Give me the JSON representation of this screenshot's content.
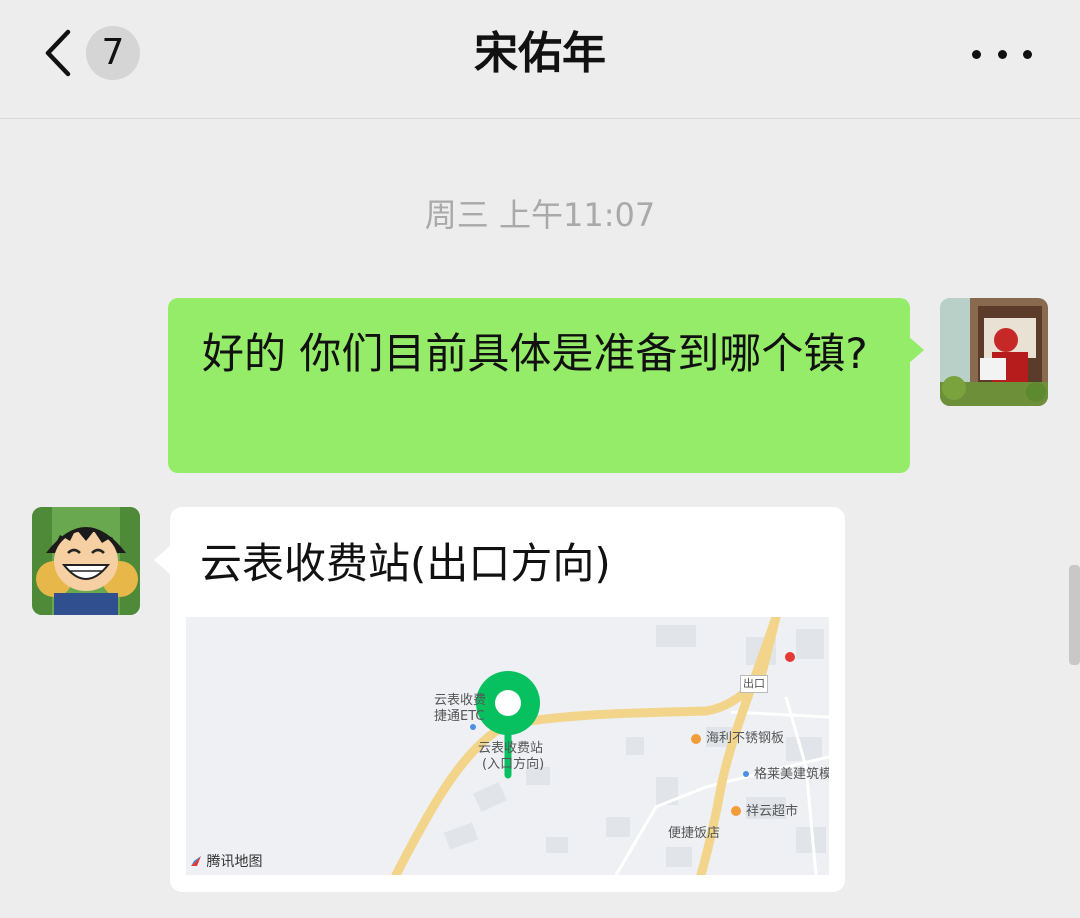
{
  "header": {
    "back_icon": "chevron-left-icon",
    "unread_count": "7",
    "title": "宋佑年",
    "more_icon": "more-dots-icon"
  },
  "chat": {
    "timestamp": "周三 上午11:07",
    "messages": [
      {
        "sender": "self",
        "type": "text",
        "text": "好的 你们目前具体是准备到哪个镇?"
      },
      {
        "sender": "contact",
        "type": "location",
        "title": "云表收费站(出口方向)"
      }
    ]
  },
  "map": {
    "labels": {
      "etc_line1": "云表收费",
      "etc_line2": "捷通ETC",
      "station_line1": "云表收费站",
      "station_line2": "(入口方向)",
      "exit": "出口",
      "steel": "海利不锈钢板",
      "gelai": "格莱美建筑模板",
      "market": "祥云超市",
      "restaurant": "便捷饭店"
    },
    "provider": "腾讯地图",
    "pin_color": "#07c160"
  },
  "colors": {
    "self_bubble": "#95ec69",
    "contact_bubble": "#ffffff",
    "background": "#ededed"
  }
}
